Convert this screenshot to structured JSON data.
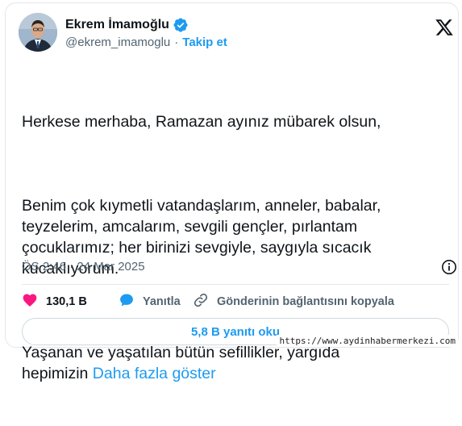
{
  "author": {
    "name": "Ekrem İmamoğlu",
    "handle": "@ekrem_imamoglu",
    "separator": "·",
    "follow_label": "Takip et"
  },
  "tweet": {
    "paragraphs": [
      "Herkese merhaba, Ramazan ayınız mübarek olsun,",
      "Benim çok kıymetli vatandaşlarım, anneler, babalar,\nteyzelerim, amcalarım, sevgili gençler, pırlantam\nçocuklarımız; her birinizi sevgiyle, saygıyla sıcacık\nkucaklıyorum."
    ],
    "last_paragraph": "Yaşanan ve yaşatılan bütün sefillikler, yargıda\nhepimizin ",
    "show_more": "Daha fazla göster",
    "timestamp": "ÖS 2:46 · 24 Mar 2025"
  },
  "actions": {
    "like_count": "130,1 B",
    "reply_label": "Yanıtla",
    "copy_link_label": "Gönderinin bağlantısını kopyala"
  },
  "read_replies": "5,8 B yanıtı oku",
  "watermark": "https://www.aydinhabermerkezi.com",
  "colors": {
    "accent": "#1d9bf0",
    "like": "#f91880",
    "text": "#0f1419",
    "secondary": "#536471"
  },
  "icons": {
    "verified": "verified-badge-icon",
    "logo": "x-logo-icon",
    "info": "info-icon",
    "like": "heart-icon",
    "reply": "speech-bubble-icon",
    "link": "link-icon"
  }
}
